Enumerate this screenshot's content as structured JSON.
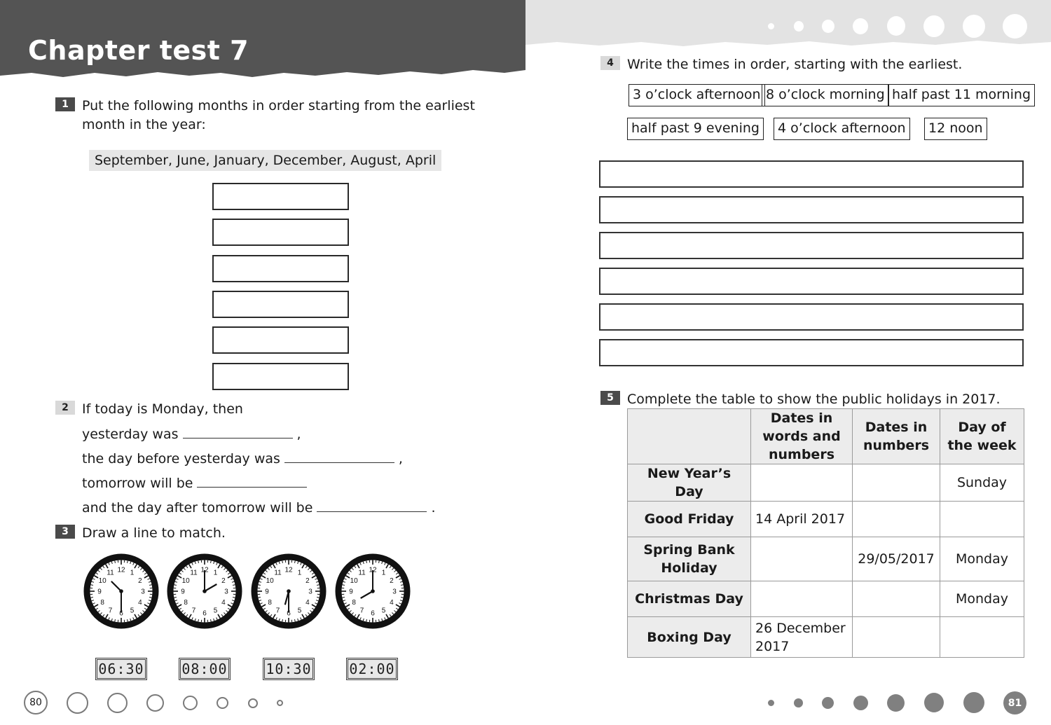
{
  "left_page": {
    "title": "Chapter test 7",
    "page_number": "80",
    "q1": {
      "number": "1",
      "text_line1": "Put the following months in order starting from the earliest",
      "text_line2": "month in the year:",
      "months_list": "September, June, January, December, August, April",
      "answer_boxes": 6
    },
    "q2": {
      "number": "2",
      "intro": "If today is Monday, then",
      "lines": [
        {
          "text": "yesterday was",
          "end": ","
        },
        {
          "text": "the day before yesterday was",
          "end": ","
        },
        {
          "text": "tomorrow will be",
          "end": ""
        },
        {
          "text": "and the day after tomorrow will be",
          "end": "."
        }
      ]
    },
    "q3": {
      "number": "3",
      "text": "Draw a line to match.",
      "analog_clocks": [
        {
          "label": "10:30",
          "hour": 10,
          "minute": 30
        },
        {
          "label": "2:00",
          "hour": 2,
          "minute": 0
        },
        {
          "label": "6:30",
          "hour": 6,
          "minute": 30
        },
        {
          "label": "8:00",
          "hour": 8,
          "minute": 0
        }
      ],
      "digital_clocks": [
        "06:30",
        "08:00",
        "10:30",
        "02:00"
      ]
    }
  },
  "right_page": {
    "page_number": "81",
    "q4": {
      "number": "4",
      "text": "Write the times in order, starting with the earliest.",
      "time_cards": [
        "3 o’clock afternoon",
        "8 o’clock morning",
        "half past 11 morning",
        "half past 9 evening",
        "4 o’clock afternoon",
        "12 noon"
      ],
      "answer_lines": 6
    },
    "q5": {
      "number": "5",
      "text": "Complete the table to show the public holidays in 2017.",
      "table": {
        "headers": [
          "",
          "Dates in words and numbers",
          "Dates in numbers",
          "Day of the week"
        ],
        "rows": [
          {
            "holiday": "New Year’s Day",
            "words": "",
            "numbers": "",
            "day": "Sunday"
          },
          {
            "holiday": "Good Friday",
            "words": "14 April 2017",
            "numbers": "",
            "day": ""
          },
          {
            "holiday": "Spring Bank Holiday",
            "words": "",
            "numbers": "29/05/2017",
            "day": "Monday"
          },
          {
            "holiday": "Christmas Day",
            "words": "",
            "numbers": "",
            "day": "Monday"
          },
          {
            "holiday": "Boxing Day",
            "words": "26 December 2017",
            "numbers": "",
            "day": ""
          }
        ]
      }
    }
  },
  "colors": {
    "banner_dark": "#545454",
    "banner_light": "#e3e3e3",
    "footer_dot": "#808080"
  }
}
